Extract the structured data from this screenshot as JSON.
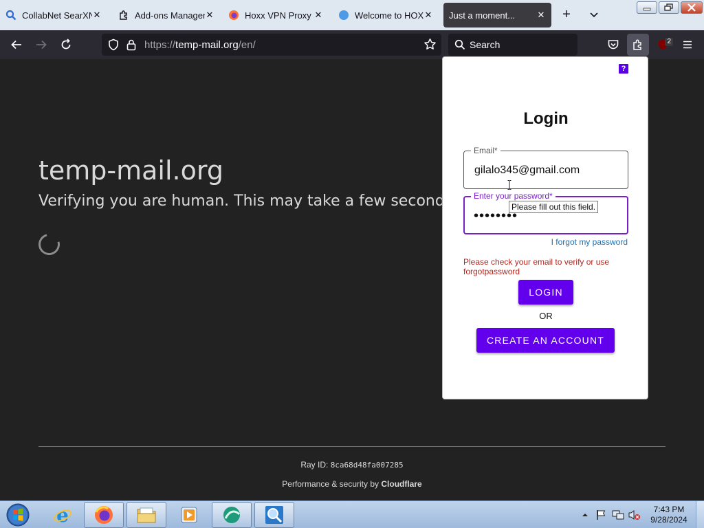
{
  "tabs": [
    {
      "title": "CollabNet SearXNG",
      "icon": "search-icon"
    },
    {
      "title": "Add-ons Manager",
      "icon": "puzzle-icon"
    },
    {
      "title": "Hoxx VPN Proxy – G",
      "icon": "firefox-icon"
    },
    {
      "title": "Welcome to HOXX",
      "icon": "globe-icon"
    },
    {
      "title": "Just a moment...",
      "icon": "none",
      "active": true
    }
  ],
  "navbar": {
    "url_prefix": "https://",
    "url_host": "temp-mail.org",
    "url_path": "/en/",
    "search_placeholder": "Search",
    "extension_badge": "2"
  },
  "page": {
    "site_title": "temp-mail.org",
    "verify_text": "Verifying you are human. This may take a few seconds.",
    "ray_label": "Ray ID: ",
    "ray_id": "8ca68d48fa007285",
    "perf_prefix": "Performance & security by ",
    "perf_brand": "Cloudflare"
  },
  "popup": {
    "help_label": "?",
    "title": "Login",
    "email_label": "Email*",
    "email_value": "gilalo345@gmail.com",
    "password_label": "Enter your password*",
    "password_value": "••••••••",
    "tooltip": "Please fill out this field.",
    "forgot_link": "I forgot my password",
    "error_text": "Please check your email to verify or use forgotpassword",
    "login_button": "LOGIN",
    "or_text": "OR",
    "create_button": "CREATE AN ACCOUNT"
  },
  "taskbar": {
    "time": "7:43 PM",
    "date": "9/28/2024"
  },
  "colors": {
    "accent": "#6200ee",
    "page_bg": "#222222",
    "error": "#b3261e",
    "link": "#1a6fb3"
  }
}
